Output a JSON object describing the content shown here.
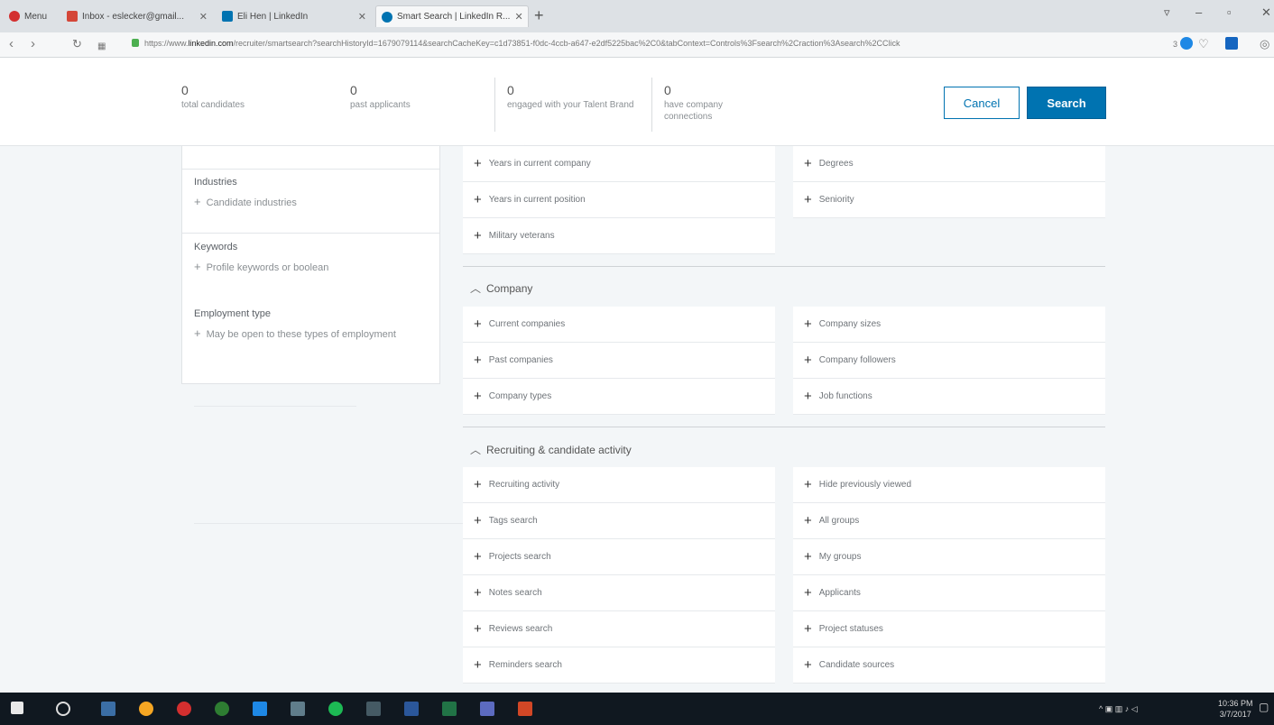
{
  "browser": {
    "tabs": [
      {
        "label": "Menu",
        "color": "#d32f2f"
      },
      {
        "label": "Inbox - eslecker@gmail...",
        "color": "#d44638"
      },
      {
        "label": "Eli Hen | LinkedIn",
        "color": "#0073b1"
      },
      {
        "label": "Smart Search | LinkedIn R...",
        "color": "#0073b1"
      }
    ],
    "new_tab": "+",
    "url_prefix": "https://www.",
    "url_domain": "linkedin.com",
    "url_rest": "/recruiter/smartsearch?searchHistoryId=1679079114&searchCacheKey=c1d73851-f0dc-4ccb-a647-e2df5225bac%2C0&tabContext=Controls%3Fsearch%2Craction%3Asearch%2CClick",
    "extra_badge": "3"
  },
  "stats": [
    {
      "num": "0",
      "label": "total candidates"
    },
    {
      "num": "0",
      "label": "past applicants"
    },
    {
      "num": "0",
      "label": "engaged with your Talent Brand"
    },
    {
      "num": "0",
      "label": "have company connections"
    }
  ],
  "actions": {
    "cancel": "Cancel",
    "search": "Search"
  },
  "left_panel": {
    "industries": {
      "title": "Industries",
      "add": "Candidate industries"
    },
    "keywords": {
      "title": "Keywords",
      "add": "Profile keywords or boolean"
    },
    "employment": {
      "title": "Employment type",
      "add": "May be open to these types of employment"
    }
  },
  "top_rows": {
    "left": [
      "Years in current company",
      "Years in current position",
      "Military veterans"
    ],
    "right": [
      "Degrees",
      "Seniority"
    ]
  },
  "company": {
    "title": "Company",
    "left": [
      "Current companies",
      "Past companies",
      "Company types"
    ],
    "right": [
      "Company sizes",
      "Company followers",
      "Job functions"
    ]
  },
  "recruiting": {
    "title": "Recruiting & candidate activity",
    "left": [
      "Recruiting activity",
      "Tags search",
      "Projects search",
      "Notes search",
      "Reviews search",
      "Reminders search"
    ],
    "right": [
      "Hide previously viewed",
      "All groups",
      "My groups",
      "Applicants",
      "Project statuses",
      "Candidate sources"
    ]
  },
  "tray": {
    "time": "10:36 PM",
    "date": "3/7/2017"
  },
  "colors": {
    "accent": "#0073b1",
    "background": "#f3f6f8",
    "taskbar": "#101820"
  }
}
